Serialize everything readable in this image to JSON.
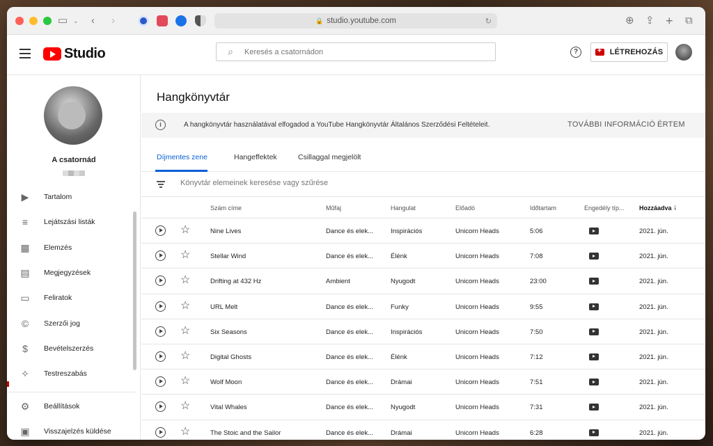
{
  "browser": {
    "url": "studio.youtube.com"
  },
  "header": {
    "logo_text": "Studio",
    "search_placeholder": "Keresés a csatornádon",
    "help_glyph": "?",
    "create_label": "LÉTREHOZÁS"
  },
  "sidebar": {
    "channel_name": "A csatornád",
    "items": [
      {
        "label": "Tartalom",
        "icon": "content-icon"
      },
      {
        "label": "Lejátszási listák",
        "icon": "playlist-icon"
      },
      {
        "label": "Elemzés",
        "icon": "analytics-icon"
      },
      {
        "label": "Megjegyzések",
        "icon": "comments-icon"
      },
      {
        "label": "Feliratok",
        "icon": "subtitles-icon"
      },
      {
        "label": "Szerzői jog",
        "icon": "copyright-icon"
      },
      {
        "label": "Bevételszerzés",
        "icon": "dollar-icon"
      },
      {
        "label": "Testreszabás",
        "icon": "wand-icon"
      }
    ],
    "bottom_items": [
      {
        "label": "Beállítások",
        "icon": "gear-icon"
      },
      {
        "label": "Visszajelzés küldése",
        "icon": "feedback-icon"
      }
    ]
  },
  "main": {
    "title": "Hangkönyvtár",
    "banner": {
      "text": "A hangkönyvtár használatával elfogadod a YouTube Hangkönyvtár Általános Szerződési Feltételeit.",
      "more": "TOVÁBBI INFORMÁCIÓ",
      "ok": "ÉRTEM"
    },
    "tabs": [
      "Díjmentes zene",
      "Hangeffektek",
      "Csillaggal megjelölt"
    ],
    "filter_placeholder": "Könyvtár elemeinek keresése vagy szűrése",
    "columns": [
      "Szám címe",
      "Műfaj",
      "Hangulat",
      "Előadó",
      "Időtartam",
      "Engedély típ...",
      "Hozzáadva"
    ],
    "sort_arrow": "↓",
    "rows": [
      {
        "title": "Nine Lives",
        "genre": "Dance és elek...",
        "mood": "Inspirációs",
        "artist": "Unicorn Heads",
        "duration": "5:06",
        "added": "2021. jún."
      },
      {
        "title": "Stellar Wind",
        "genre": "Dance és elek...",
        "mood": "Élénk",
        "artist": "Unicorn Heads",
        "duration": "7:08",
        "added": "2021. jún."
      },
      {
        "title": "Drifting at 432 Hz",
        "genre": "Ambient",
        "mood": "Nyugodt",
        "artist": "Unicorn Heads",
        "duration": "23:00",
        "added": "2021. jún."
      },
      {
        "title": "URL Melt",
        "genre": "Dance és elek...",
        "mood": "Funky",
        "artist": "Unicorn Heads",
        "duration": "9:55",
        "added": "2021. jún."
      },
      {
        "title": "Six Seasons",
        "genre": "Dance és elek...",
        "mood": "Inspirációs",
        "artist": "Unicorn Heads",
        "duration": "7:50",
        "added": "2021. jún."
      },
      {
        "title": "Digital Ghosts",
        "genre": "Dance és elek...",
        "mood": "Élénk",
        "artist": "Unicorn Heads",
        "duration": "7:12",
        "added": "2021. jún."
      },
      {
        "title": "Wolf Moon",
        "genre": "Dance és elek...",
        "mood": "Drámai",
        "artist": "Unicorn Heads",
        "duration": "7:51",
        "added": "2021. jún."
      },
      {
        "title": "Vital Whales",
        "genre": "Dance és elek...",
        "mood": "Nyugodt",
        "artist": "Unicorn Heads",
        "duration": "7:31",
        "added": "2021. jún."
      },
      {
        "title": "The Stoic and the Sailor",
        "genre": "Dance és elek...",
        "mood": "Drámai",
        "artist": "Unicorn Heads",
        "duration": "6:28",
        "added": "2021. jún."
      }
    ]
  },
  "colors": {
    "accent": "#065fd4",
    "brand_red": "#ff0000"
  }
}
